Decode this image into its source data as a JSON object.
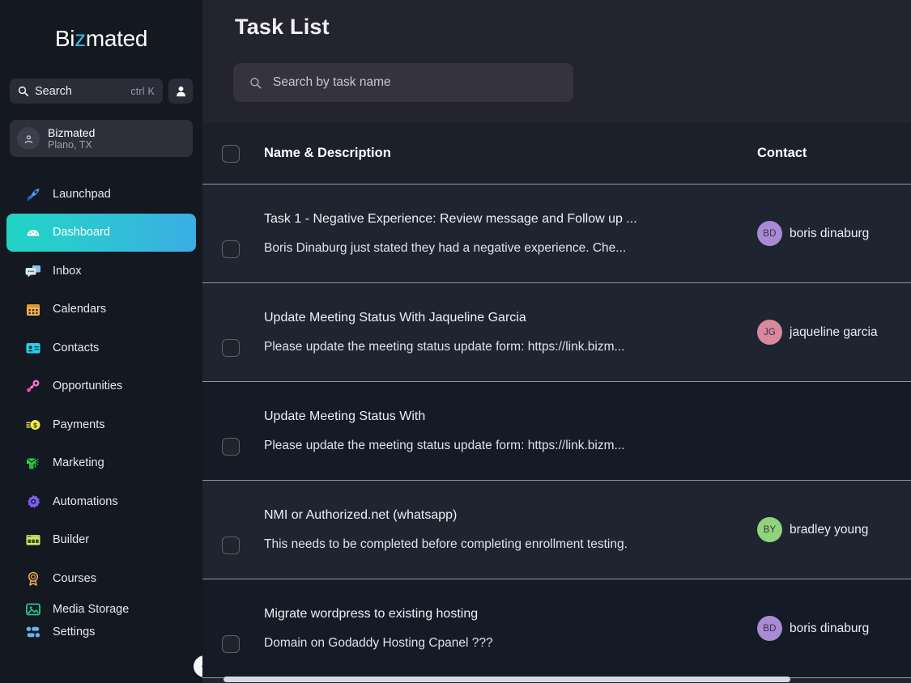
{
  "sidebar": {
    "logo": {
      "prefix": "Bi",
      "accent": "z",
      "suffix": "mated",
      "accent_color": "#35b8e0"
    },
    "search": {
      "label": "Search",
      "shortcut": "ctrl K",
      "icon": "search-icon"
    },
    "user_button_icon": "user-avatar-icon",
    "workspace": {
      "name": "Bizmated",
      "location": "Plano, TX",
      "icon": "location-pin-icon"
    },
    "items": [
      {
        "label": "Launchpad",
        "icon": "rocket-icon",
        "color": "#3b82f6",
        "active": false
      },
      {
        "label": "Dashboard",
        "icon": "dashboard-icon",
        "color": "#ffffff",
        "active": true
      },
      {
        "label": "Inbox",
        "icon": "chat-bubble-icon",
        "color": "#93c5ee",
        "active": false
      },
      {
        "label": "Calendars",
        "icon": "calendar-icon",
        "color": "#f0b45c",
        "active": false
      },
      {
        "label": "Contacts",
        "icon": "contact-card-icon",
        "color": "#22d3ee",
        "active": false
      },
      {
        "label": "Opportunities",
        "icon": "opportunity-icon",
        "color": "#f06fc8",
        "active": false
      },
      {
        "label": "Payments",
        "icon": "coin-dollar-icon",
        "color": "#f2e94e",
        "active": false
      },
      {
        "label": "Marketing",
        "icon": "megaphone-mail-icon",
        "color": "#2fd44e",
        "active": false
      },
      {
        "label": "Automations",
        "icon": "gear-icon",
        "color": "#7c5cf5",
        "active": false
      },
      {
        "label": "Builder",
        "icon": "window-builder-icon",
        "color": "#cdec6a",
        "active": false
      },
      {
        "label": "Courses",
        "icon": "award-ribbon-icon",
        "color": "#e8a85a",
        "active": false
      },
      {
        "label": "Media Storage",
        "icon": "image-icon",
        "color": "#22c98a",
        "active": false
      },
      {
        "label": "Settings",
        "icon": "sliders-icon",
        "color": "#64b4ec",
        "active": false
      }
    ],
    "collapse_icon": "chevron-left-icon",
    "active_gradient": {
      "from": "#21d4c4",
      "to": "#3aaee4"
    }
  },
  "main": {
    "title": "Task List",
    "search": {
      "placeholder": "Search by task name",
      "icon": "search-icon",
      "value": ""
    },
    "table": {
      "columns": {
        "check": "select-all-checkbox",
        "name": "Name & Description",
        "contact": "Contact"
      },
      "rows": [
        {
          "title": "Task 1 - Negative Experience: Review message and Follow up ...",
          "description": "Boris Dinaburg just stated they had a negative experience. Che...",
          "contact": {
            "name": "boris dinaburg",
            "initials": "BD",
            "color": "#a98ad4"
          },
          "shade": "light"
        },
        {
          "title": "Update Meeting Status With Jaqueline Garcia",
          "description": "Please update the meeting status update form: https://link.bizm...",
          "contact": {
            "name": "jaqueline garcia",
            "initials": "JG",
            "color": "#d9889d"
          },
          "shade": "light"
        },
        {
          "title": "Update Meeting Status With",
          "description": "Please update the meeting status update form: https://link.bizm...",
          "contact": {
            "name": "",
            "initials": "",
            "color": ""
          },
          "shade": "dark"
        },
        {
          "title": "NMI or Authorized.net (whatsapp)",
          "description": "This needs to be completed before completing enrollment testing.",
          "contact": {
            "name": "bradley young",
            "initials": "BY",
            "color": "#8fd47a"
          },
          "shade": "light"
        },
        {
          "title": "Migrate wordpress to existing hosting",
          "description": "Domain on Godaddy Hosting Cpanel ???",
          "contact": {
            "name": "boris dinaburg",
            "initials": "BD",
            "color": "#a98ad4"
          },
          "shade": "dark"
        }
      ]
    }
  }
}
